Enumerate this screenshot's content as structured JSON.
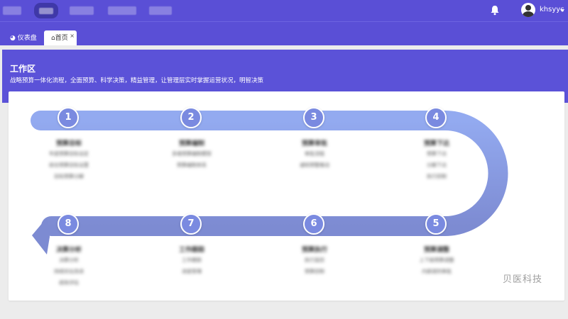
{
  "header": {
    "username": "khsyyc",
    "nav_items": [
      "",
      "",
      "",
      "",
      "",
      ""
    ]
  },
  "tabs": [
    {
      "icon": "dashboard-icon",
      "label": "仪表盘"
    },
    {
      "icon": "home-icon",
      "label": "首页",
      "close": "×"
    }
  ],
  "hero": {
    "title": "工作区",
    "subtitle": "战略预算一体化流程，全面预算、科学决策，精益管理，让管理层实时掌握运营状况，明智决策"
  },
  "steps": [
    {
      "num": "1",
      "title": "预算目标",
      "lines": [
        "年度预算目标设定",
        "综合预算目标设置",
        "目标预算分解"
      ]
    },
    {
      "num": "2",
      "title": "预算编制",
      "lines": [
        "多维预算编制模型",
        "预算编制体系"
      ]
    },
    {
      "num": "3",
      "title": "预算审批",
      "lines": [
        "审批流程",
        "通知预警推动"
      ]
    },
    {
      "num": "4",
      "title": "预算下达",
      "lines": [
        "预算下达",
        "分解下达",
        "执行控制"
      ]
    },
    {
      "num": "5",
      "title": "预算调整",
      "lines": [
        "上下级预算调整",
        "内部调剂审批"
      ]
    },
    {
      "num": "6",
      "title": "预算执行",
      "lines": [
        "执行监控",
        "预算控制"
      ]
    },
    {
      "num": "7",
      "title": "工作跟踪",
      "lines": [
        "工作跟踪",
        "进度管理"
      ]
    },
    {
      "num": "8",
      "title": "决算分析",
      "lines": [
        "决算分析",
        "持续优化改进",
        "绩效评估"
      ]
    }
  ],
  "watermark": "贝医科技",
  "colors": {
    "primary": "#5b52d8",
    "road_top": "#8fa6ee",
    "road_bottom": "#7f8dd6",
    "step": "#7a8ae0"
  }
}
